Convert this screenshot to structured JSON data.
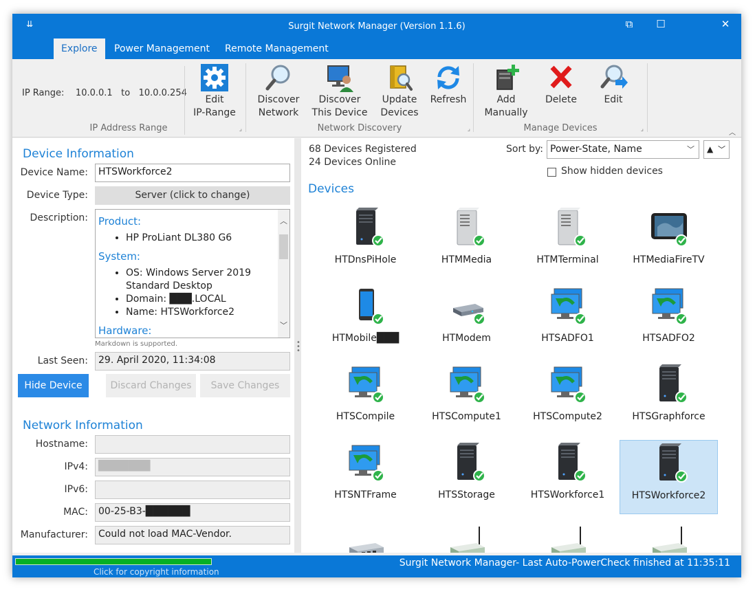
{
  "window": {
    "title": "Surgit Network Manager  (Version 1.1.6)",
    "sysmenu_glyph": "⇊",
    "buttons": {
      "compact": "⧉",
      "maximize": "☐",
      "close": "✕"
    }
  },
  "tabs": [
    {
      "label": "Explore",
      "active": true
    },
    {
      "label": "Power Management",
      "active": false
    },
    {
      "label": "Remote Management",
      "active": false
    }
  ],
  "ribbon": {
    "ip_range": {
      "label": "IP Range:",
      "from": "10.0.0.1",
      "to_word": "to",
      "to": "10.0.0.254"
    },
    "groups": [
      {
        "label": "IP Address Range",
        "buttons": [
          {
            "line1": "Edit",
            "line2": "IP-Range",
            "icon": "gear-icon"
          }
        ]
      },
      {
        "label": "Network Discovery",
        "buttons": [
          {
            "line1": "Discover",
            "line2": "Network",
            "icon": "magnifier-icon"
          },
          {
            "line1": "Discover",
            "line2": "This Device",
            "icon": "computer-user-icon"
          },
          {
            "line1": "Update",
            "line2": "Devices",
            "icon": "update-devices-icon"
          },
          {
            "line1": "Refresh",
            "line2": "",
            "icon": "refresh-icon"
          }
        ]
      },
      {
        "label": "Manage Devices",
        "buttons": [
          {
            "line1": "Add",
            "line2": "Manually",
            "icon": "add-device-icon"
          },
          {
            "line1": "Delete",
            "line2": "",
            "icon": "delete-x-icon"
          },
          {
            "line1": "Edit",
            "line2": "",
            "icon": "edit-magnifier-icon"
          }
        ]
      }
    ]
  },
  "device_info": {
    "section_title": "Device Information",
    "name_label": "Device Name:",
    "name_value": "HTSWorkforce2",
    "type_label": "Device Type:",
    "type_value": "Server (click to change)",
    "desc_label": "Description:",
    "desc": {
      "h_product": "Product:",
      "product_items": [
        "HP ProLiant DL380 G6"
      ],
      "h_system": "System:",
      "system_items": [
        "OS: Windows Server 2019 Standard Desktop",
        "Domain: ███.LOCAL",
        "Name: HTSWorkforce2"
      ],
      "h_hardware": "Hardware:"
    },
    "markdown_hint": "Markdown is supported.",
    "last_seen_label": "Last Seen:",
    "last_seen_value": "29. April 2020, 11:34:08",
    "hide_button": "Hide Device",
    "discard_button": "Discard Changes",
    "save_button": "Save Changes"
  },
  "network_info": {
    "section_title": "Network Information",
    "hostname_label": "Hostname:",
    "hostname_value": "",
    "ipv4_label": "IPv4:",
    "ipv4_value": "███████",
    "ipv6_label": "IPv6:",
    "ipv6_value": "",
    "mac_label": "MAC:",
    "mac_value": "00-25-B3-██████",
    "manufacturer_label": "Manufacturer:",
    "manufacturer_value": "Could not load MAC-Vendor."
  },
  "devices_panel": {
    "registered": "68 Devices Registered",
    "online": "24 Devices Online",
    "sort_label": "Sort by:",
    "sort_value": "Power-State, Name",
    "order_glyph": "▲",
    "show_hidden_label": "Show hidden devices",
    "show_hidden_checked": false,
    "title": "Devices",
    "devices": [
      {
        "name": "HTDnsPiHole",
        "kind": "server"
      },
      {
        "name": "HTMMedia",
        "kind": "server-light"
      },
      {
        "name": "HTMTerminal",
        "kind": "server-light"
      },
      {
        "name": "HTMediaFireTV",
        "kind": "tablet"
      },
      {
        "name": "HTMobile███",
        "kind": "phone"
      },
      {
        "name": "HTModem",
        "kind": "modem"
      },
      {
        "name": "HTSADFO1",
        "kind": "remote"
      },
      {
        "name": "HTSADFO2",
        "kind": "remote"
      },
      {
        "name": "HTSCompile",
        "kind": "remote"
      },
      {
        "name": "HTSCompute1",
        "kind": "remote"
      },
      {
        "name": "HTSCompute2",
        "kind": "remote"
      },
      {
        "name": "HTSGraphforce",
        "kind": "server"
      },
      {
        "name": "HTSNTFrame",
        "kind": "remote"
      },
      {
        "name": "HTSStorage",
        "kind": "server"
      },
      {
        "name": "HTSWorkforce1",
        "kind": "server"
      },
      {
        "name": "HTSWorkforce2",
        "kind": "server",
        "selected": true
      },
      {
        "name": "",
        "kind": "switch"
      },
      {
        "name": "",
        "kind": "router"
      },
      {
        "name": "",
        "kind": "router"
      },
      {
        "name": "",
        "kind": "router"
      }
    ]
  },
  "statusbar": {
    "progress": 1.0,
    "copyright": "Click for copyright information",
    "text": "Surgit Network Manager- Last Auto-PowerCheck finished at 11:35:11"
  }
}
